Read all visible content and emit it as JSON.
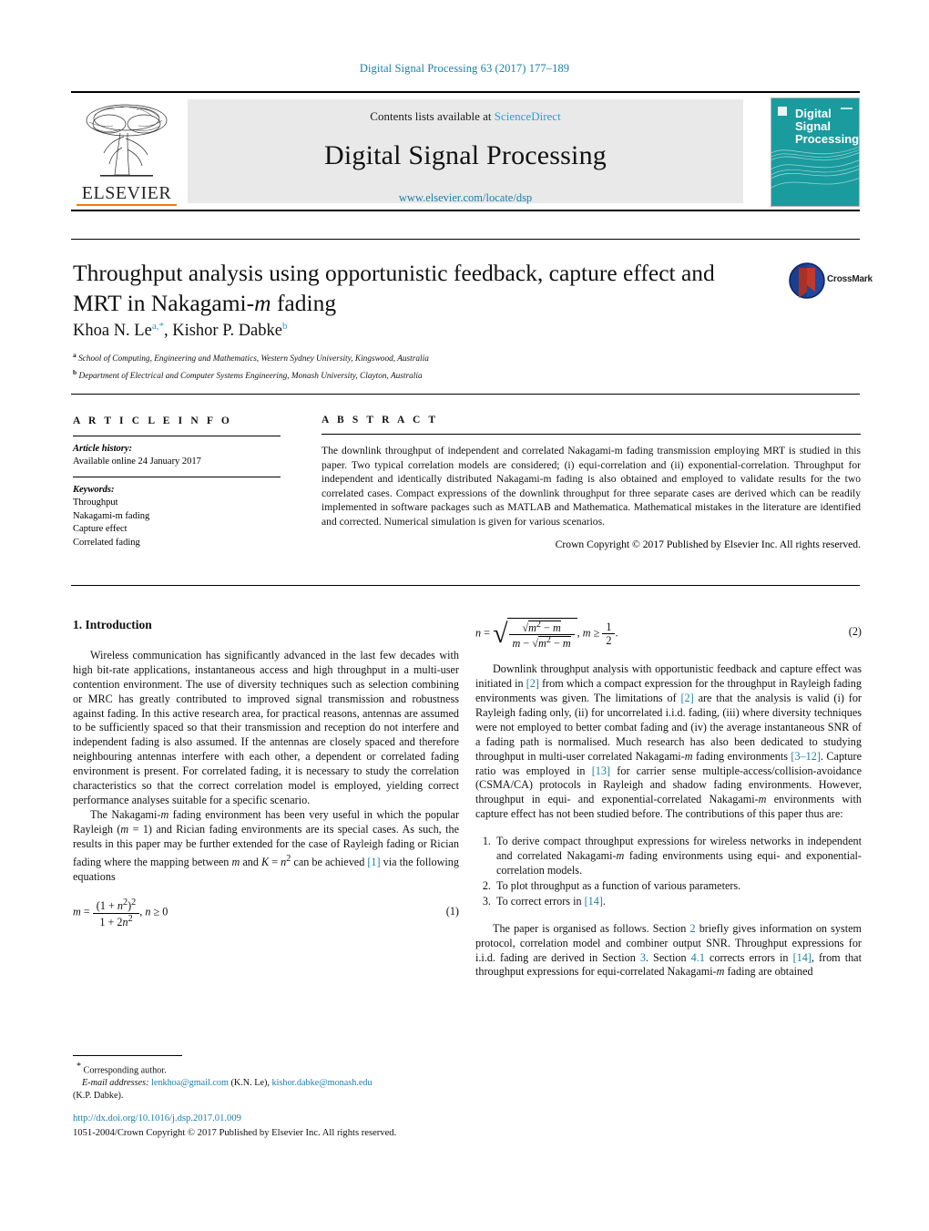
{
  "running_head": "Digital Signal Processing 63 (2017) 177–189",
  "masthead": {
    "contents_prefix": "Contents lists available at ",
    "sciencedirect": "ScienceDirect",
    "journal_name": "Digital Signal Processing",
    "journal_url": "www.elsevier.com/locate/dsp",
    "publisher": "ELSEVIER",
    "cover_title_line1": "Digital",
    "cover_title_line2": "Signal",
    "cover_title_line3": "Processing",
    "accent_teal": "#159a9c",
    "accent_orange": "#f07d00",
    "link_blue": "#2a9fd6"
  },
  "article": {
    "title_line1": "Throughput analysis using opportunistic feedback, capture effect and",
    "title_line2_pre": "MRT in Nakagami-",
    "title_line2_em": "m",
    "title_line2_post": " fading",
    "crossmark_label": "CrossMark",
    "authors": [
      {
        "name": "Khoa N. Le",
        "marks": "a,*"
      },
      {
        "name": "Kishor P. Dabke",
        "marks": "b"
      }
    ],
    "affiliations": [
      {
        "mark": "a",
        "text": "School of Computing, Engineering and Mathematics, Western Sydney University, Kingswood, Australia"
      },
      {
        "mark": "b",
        "text": "Department of Electrical and Computer Systems Engineering, Monash University, Clayton, Australia"
      }
    ]
  },
  "info": {
    "heading": "A R T I C L E    I N F O",
    "history_label": "Article history:",
    "history_value": "Available online 24 January 2017",
    "keywords_label": "Keywords:",
    "keywords": [
      "Throughput",
      "Nakagami-m fading",
      "Capture effect",
      "Correlated fading"
    ]
  },
  "abstract": {
    "heading": "A B S T R A C T",
    "body": "The downlink throughput of independent and correlated Nakagami-m fading transmission employing MRT is studied in this paper. Two typical correlation models are considered; (i) equi-correlation and (ii) exponential-correlation. Throughput for independent and identically distributed Nakagami-m fading is also obtained and employed to validate results for the two correlated cases. Compact expressions of the downlink throughput for three separate cases are derived which can be readily implemented in software packages such as MATLAB and Mathematica. Mathematical mistakes in the literature are identified and corrected. Numerical simulation is given for various scenarios.",
    "copyright": "Crown Copyright © 2017 Published by Elsevier Inc. All rights reserved."
  },
  "body": {
    "section1_heading": "1. Introduction",
    "para1": "Wireless communication has significantly advanced in the last few decades with high bit-rate applications, instantaneous access and high throughput in a multi-user contention environment. The use of diversity techniques such as selection combining or MRC has greatly contributed to improved signal transmission and robustness against fading. In this active research area, for practical reasons, antennas are assumed to be sufficiently spaced so that their transmission and reception do not interfere and independent fading is also assumed. If the antennas are closely spaced and therefore neighbouring antennas interfere with each other, a dependent or correlated fading environment is present. For correlated fading, it is necessary to study the correlation characteristics so that the correct correlation model is employed, yielding correct performance analyses suitable for a specific scenario.",
    "para2_a": "The Nakagami-",
    "para2_b": " fading environment has been very useful in which the popular Rayleigh (",
    "para2_c": " = 1) and Rician fading environments are its special cases. As such, the results in this paper may be further extended for the case of Rayleigh fading or Rician fading where the mapping between ",
    "para2_d": " and ",
    "para2_e": " can be achieved ",
    "para2_cite": "[1]",
    "para2_f": " via the following equations",
    "eq1_number": "(1)",
    "eq2_number": "(2)",
    "para3_a": "Downlink throughput analysis with opportunistic feedback and capture effect was initiated in ",
    "para3_c2": "[2]",
    "para3_b": " from which a compact expression for the throughput in Rayleigh fading environments was given. The limitations of ",
    "para3_c3": "[2]",
    "para3_d": " are that the analysis is valid (i) for Rayleigh fading only, (ii) for uncorrelated i.i.d. fading, (iii) where diversity techniques were not employed to better combat fading and (iv) the average instantaneous SNR of a fading path is normalised. Much research has also been dedicated to studying throughput in multi-user correlated Nakagami-",
    "para3_e": " fading environments ",
    "para3_c4": "[3–12]",
    "para3_f": ". Capture ratio was employed in ",
    "para3_c5": "[13]",
    "para3_g": " for carrier sense multiple-access/collision-avoidance (CSMA/CA) protocols in Rayleigh and shadow fading environments. However, throughput in equi- and exponential-correlated Nakagami-",
    "para3_h": " environments with capture effect has not been studied before. The contributions of this paper thus are:",
    "contributions": [
      {
        "a": "To derive compact throughput expressions for wireless networks in independent and correlated Nakagami-",
        "em": "m",
        "b": " fading environments using equi- and exponential-correlation models."
      },
      {
        "a": "To plot throughput as a function of various parameters.",
        "em": "",
        "b": ""
      },
      {
        "a": "To correct errors in ",
        "cite": "[14]",
        "b": "."
      }
    ],
    "para4_a": "The paper is organised as follows. Section ",
    "para4_s2": "2",
    "para4_b": " briefly gives information on system protocol, correlation model and combiner output SNR. Throughput expressions for i.i.d. fading are derived in Section ",
    "para4_s3": "3",
    "para4_c": ". Section ",
    "para4_s41": "4.1",
    "para4_d": " corrects errors in ",
    "para4_c14": "[14]",
    "para4_e": ", from that throughput expressions for equi-correlated Nakagami-",
    "para4_f": " fading are obtained"
  },
  "footer": {
    "corresponding_mark": "*",
    "corresponding_text": "Corresponding author.",
    "email_label": "E-mail addresses:",
    "email1": "lenkhoa@gmail.com",
    "email1_owner": "(K.N. Le),",
    "email2": "kishor.dabke@monash.edu",
    "email2_owner": "(K.P. Dabke).",
    "doi": "http://dx.doi.org/10.1016/j.dsp.2017.01.009",
    "issn_line": "1051-2004/Crown Copyright © 2017 Published by Elsevier Inc. All rights reserved."
  }
}
